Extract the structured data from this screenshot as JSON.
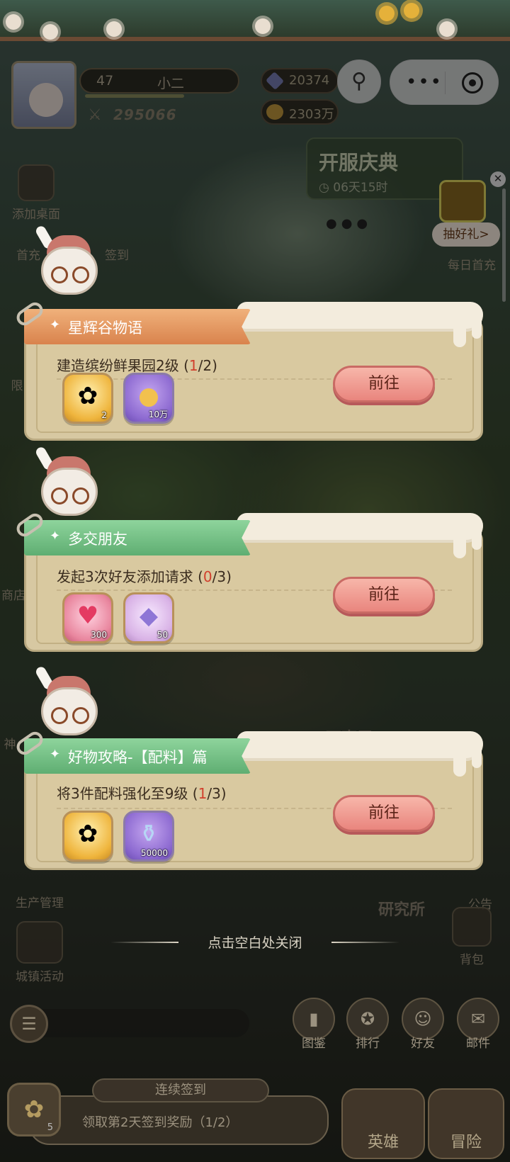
{
  "hud": {
    "level": "47",
    "player_name": "小二",
    "power": "295066",
    "diamonds": "20374",
    "gold": "2303万"
  },
  "event_banner": {
    "title": "开服庆典",
    "timer": "06天15时"
  },
  "lucky_gift": {
    "label": "抽好礼>"
  },
  "side_left": [
    {
      "label": "添加桌面"
    },
    {
      "label": "首充"
    },
    {
      "label": "签到"
    },
    {
      "label": "限"
    },
    {
      "label": "商店"
    },
    {
      "label": "神"
    },
    {
      "label": "生产管理"
    },
    {
      "label": "城镇活动"
    }
  ],
  "side_right": [
    {
      "label": "每日首充"
    },
    {
      "label": "公告"
    },
    {
      "label": "背包"
    }
  ],
  "bg_buildings": {
    "wanshi": "万事屋",
    "research": "研究所"
  },
  "quests": [
    {
      "title": "星辉谷物语",
      "desc_text": "建造缤纷鲜果园2级 (",
      "progress_cur": "1",
      "progress_total": "/2)",
      "rewards": [
        {
          "icon": "cookie-fairy-icon",
          "qty": "2"
        },
        {
          "icon": "gold-coin-icon",
          "qty": "10万"
        }
      ],
      "button": "前往",
      "ribbon_color": "#e09158"
    },
    {
      "title": "多交朋友",
      "desc_text": "发起3次好友添加请求 (",
      "progress_cur": "0",
      "progress_total": "/3)",
      "rewards": [
        {
          "icon": "winged-heart-icon",
          "qty": "300"
        },
        {
          "icon": "diamond-icon",
          "qty": "50"
        }
      ],
      "button": "前往",
      "ribbon_color": "#6bb87c"
    },
    {
      "title": "好物攻略-【配料】篇",
      "desc_text": "将3件配料强化至9级 (",
      "progress_cur": "1",
      "progress_total": "/3)",
      "rewards": [
        {
          "icon": "cookie-fairy-icon",
          "qty": ""
        },
        {
          "icon": "potion-bottle-icon",
          "qty": "50000"
        }
      ],
      "button": "前往",
      "ribbon_color": "#6bb87c"
    }
  ],
  "close_hint": "点击空白处关闭",
  "bottom_nav": [
    {
      "label": "图鉴",
      "icon": "book-icon"
    },
    {
      "label": "排行",
      "icon": "medal-icon"
    },
    {
      "label": "好友",
      "icon": "friends-icon"
    },
    {
      "label": "邮件",
      "icon": "mail-icon"
    }
  ],
  "checkin": {
    "header": "连续签到",
    "text": "领取第2天签到奖励（1/2）",
    "badge": "5"
  },
  "big_buttons": {
    "hero": "英雄",
    "adventure": "冒险"
  },
  "colors": {
    "progress_highlight": "#d1402d",
    "go_button": "#e9857e"
  }
}
